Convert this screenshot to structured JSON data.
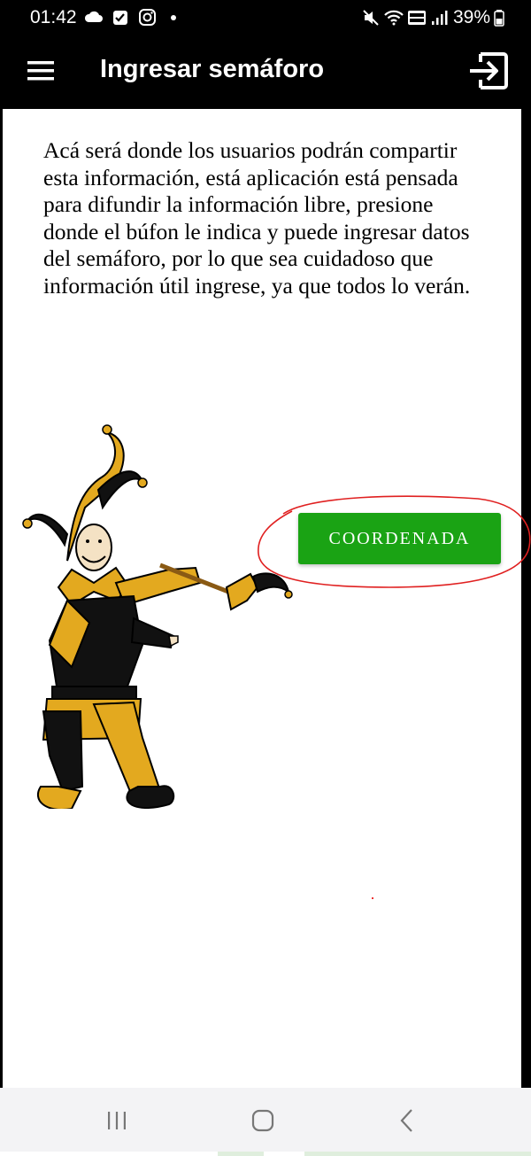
{
  "status_bar": {
    "time": "01:42",
    "battery": "39%",
    "left_icons": [
      "cloud-icon",
      "checkbox-icon",
      "instagram-icon",
      "dot-icon"
    ],
    "right_icons": [
      "mute-icon",
      "wifi-icon",
      "volte-icon",
      "signal-icon",
      "battery-icon"
    ]
  },
  "app_bar": {
    "title": "Ingresar semáforo",
    "menu_icon": "hamburger-menu-icon",
    "logout_icon": "logout-icon"
  },
  "main": {
    "intro_text": "Acá será donde los usuarios podrán compartir esta información, está aplicación está pensada para difundir la información libre, presione donde el búfon le indica y puede ingresar datos del semáforo, por lo que sea cuidadoso que información útil ingrese, ya que todos lo verán.",
    "coordenada_button": "COORDENADA",
    "jester_image": "jester-illustration",
    "annotation_color": "#e02020",
    "button_color": "#1aa314"
  },
  "nav_bar": {
    "icons": [
      "recents-icon",
      "home-icon",
      "back-icon"
    ]
  }
}
